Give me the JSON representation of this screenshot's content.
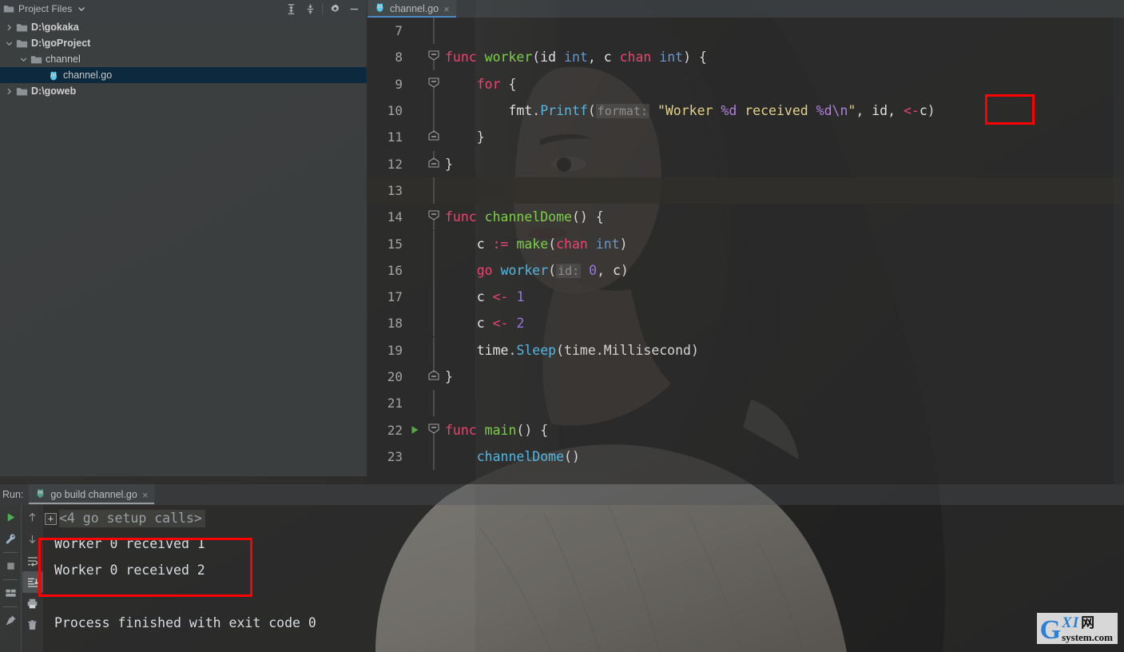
{
  "window": {
    "theme_accent": "#4a88c7",
    "annotation_color": "#ff0000"
  },
  "project_panel": {
    "title": "Project Files",
    "icons": {
      "dropdown": "chevron-down-icon",
      "expand_all": "expand-all-icon",
      "collapse_all": "collapse-all-icon",
      "settings": "gear-icon",
      "hide": "minimize-icon"
    },
    "tree": [
      {
        "label": "D:\\gokaka",
        "depth": 1,
        "kind": "folder",
        "expanded": false,
        "bold": true,
        "selected": false
      },
      {
        "label": "D:\\goProject",
        "depth": 1,
        "kind": "folder",
        "expanded": true,
        "bold": true,
        "selected": false
      },
      {
        "label": "channel",
        "depth": 2,
        "kind": "folder",
        "expanded": true,
        "bold": false,
        "selected": false
      },
      {
        "label": "channel.go",
        "depth": 3,
        "kind": "gofile",
        "expanded": null,
        "bold": false,
        "selected": true
      },
      {
        "label": "D:\\goweb",
        "depth": 1,
        "kind": "folder",
        "expanded": false,
        "bold": true,
        "selected": false
      }
    ]
  },
  "editor": {
    "tab": {
      "label": "channel.go",
      "icon": "go-gopher-icon",
      "close": "×",
      "active": true
    },
    "current_line": 13,
    "run_marker_line": 22,
    "lines": [
      {
        "n": 7,
        "fold": "none",
        "run": false,
        "current": false,
        "tokens": []
      },
      {
        "n": 8,
        "fold": "open",
        "run": false,
        "current": false,
        "tokens": [
          {
            "t": "func ",
            "c": "t-kw2"
          },
          {
            "t": "worker",
            "c": "t-fn"
          },
          {
            "t": "(",
            "c": "t-plain"
          },
          {
            "t": "id ",
            "c": "t-var"
          },
          {
            "t": "int",
            "c": "t-type"
          },
          {
            "t": ", ",
            "c": "t-plain"
          },
          {
            "t": "c ",
            "c": "t-var"
          },
          {
            "t": "chan ",
            "c": "t-kw2"
          },
          {
            "t": "int",
            "c": "t-type"
          },
          {
            "t": ") {",
            "c": "t-plain"
          }
        ]
      },
      {
        "n": 9,
        "fold": "open",
        "run": false,
        "current": false,
        "tokens": [
          {
            "t": "    ",
            "c": "t-plain"
          },
          {
            "t": "for",
            "c": "t-kw2"
          },
          {
            "t": " {",
            "c": "t-plain"
          }
        ]
      },
      {
        "n": 10,
        "fold": "none",
        "run": false,
        "current": false,
        "tokens": [
          {
            "t": "        ",
            "c": "t-plain"
          },
          {
            "t": "fmt",
            "c": "t-var"
          },
          {
            "t": ".",
            "c": "t-plain"
          },
          {
            "t": "Printf",
            "c": "t-call"
          },
          {
            "t": "(",
            "c": "t-plain"
          },
          {
            "t": "format:",
            "c": "hint"
          },
          {
            "t": "\"Worker ",
            "c": "t-str"
          },
          {
            "t": "%d",
            "c": "t-fmt"
          },
          {
            "t": " received ",
            "c": "t-str"
          },
          {
            "t": "%d",
            "c": "t-fmt"
          },
          {
            "t": "\\n",
            "c": "t-fmt"
          },
          {
            "t": "\"",
            "c": "t-str"
          },
          {
            "t": ", ",
            "c": "t-plain"
          },
          {
            "t": "id",
            "c": "t-var"
          },
          {
            "t": ", ",
            "c": "t-plain"
          },
          {
            "t": "<-",
            "c": "t-arrow"
          },
          {
            "t": "c",
            "c": "t-var"
          },
          {
            "t": ")",
            "c": "t-plain"
          }
        ]
      },
      {
        "n": 11,
        "fold": "close",
        "run": false,
        "current": false,
        "tokens": [
          {
            "t": "    }",
            "c": "t-plain"
          }
        ]
      },
      {
        "n": 12,
        "fold": "close",
        "run": false,
        "current": false,
        "tokens": [
          {
            "t": "}",
            "c": "t-plain"
          }
        ]
      },
      {
        "n": 13,
        "fold": "none",
        "run": false,
        "current": true,
        "tokens": []
      },
      {
        "n": 14,
        "fold": "open",
        "run": false,
        "current": false,
        "tokens": [
          {
            "t": "func ",
            "c": "t-kw2"
          },
          {
            "t": "channelDome",
            "c": "t-fn"
          },
          {
            "t": "() {",
            "c": "t-plain"
          }
        ]
      },
      {
        "n": 15,
        "fold": "none",
        "run": false,
        "current": false,
        "tokens": [
          {
            "t": "    ",
            "c": "t-plain"
          },
          {
            "t": "c ",
            "c": "t-var"
          },
          {
            "t": ":=",
            "c": "t-arrow"
          },
          {
            "t": " ",
            "c": "t-plain"
          },
          {
            "t": "make",
            "c": "t-fn"
          },
          {
            "t": "(",
            "c": "t-plain"
          },
          {
            "t": "chan ",
            "c": "t-kw2"
          },
          {
            "t": "int",
            "c": "t-type"
          },
          {
            "t": ")",
            "c": "t-plain"
          }
        ]
      },
      {
        "n": 16,
        "fold": "none",
        "run": false,
        "current": false,
        "tokens": [
          {
            "t": "    ",
            "c": "t-plain"
          },
          {
            "t": "go ",
            "c": "t-kw2"
          },
          {
            "t": "worker",
            "c": "t-call"
          },
          {
            "t": "(",
            "c": "t-plain"
          },
          {
            "t": "id:",
            "c": "hint"
          },
          {
            "t": "0",
            "c": "t-num"
          },
          {
            "t": ", ",
            "c": "t-plain"
          },
          {
            "t": "c",
            "c": "t-var"
          },
          {
            "t": ")",
            "c": "t-plain"
          }
        ]
      },
      {
        "n": 17,
        "fold": "none",
        "run": false,
        "current": false,
        "tokens": [
          {
            "t": "    ",
            "c": "t-plain"
          },
          {
            "t": "c ",
            "c": "t-var"
          },
          {
            "t": "<-",
            "c": "t-arrow"
          },
          {
            "t": " ",
            "c": "t-plain"
          },
          {
            "t": "1",
            "c": "t-num"
          }
        ]
      },
      {
        "n": 18,
        "fold": "none",
        "run": false,
        "current": false,
        "tokens": [
          {
            "t": "    ",
            "c": "t-plain"
          },
          {
            "t": "c ",
            "c": "t-var"
          },
          {
            "t": "<-",
            "c": "t-arrow"
          },
          {
            "t": " ",
            "c": "t-plain"
          },
          {
            "t": "2",
            "c": "t-num"
          }
        ]
      },
      {
        "n": 19,
        "fold": "none",
        "run": false,
        "current": false,
        "tokens": [
          {
            "t": "    ",
            "c": "t-plain"
          },
          {
            "t": "time",
            "c": "t-var"
          },
          {
            "t": ".",
            "c": "t-plain"
          },
          {
            "t": "Sleep",
            "c": "t-call"
          },
          {
            "t": "(time.Millisecond)",
            "c": "t-plain"
          }
        ]
      },
      {
        "n": 20,
        "fold": "close",
        "run": false,
        "current": false,
        "tokens": [
          {
            "t": "}",
            "c": "t-plain"
          }
        ]
      },
      {
        "n": 21,
        "fold": "none",
        "run": false,
        "current": false,
        "tokens": []
      },
      {
        "n": 22,
        "fold": "open",
        "run": true,
        "current": false,
        "tokens": [
          {
            "t": "func ",
            "c": "t-kw2"
          },
          {
            "t": "main",
            "c": "t-fn"
          },
          {
            "t": "() {",
            "c": "t-plain"
          }
        ]
      },
      {
        "n": 23,
        "fold": "none",
        "run": false,
        "current": false,
        "tokens": [
          {
            "t": "    ",
            "c": "t-plain"
          },
          {
            "t": "channelDome",
            "c": "t-call"
          },
          {
            "t": "()",
            "c": "t-plain"
          }
        ]
      }
    ]
  },
  "run_panel": {
    "label": "Run:",
    "tab": {
      "label": "go build channel.go",
      "icon": "go-gopher-icon",
      "close": "×"
    },
    "left_rail": [
      {
        "name": "rerun-button",
        "icon": "play-icon"
      },
      {
        "name": "settings-button",
        "icon": "wrench-icon"
      },
      {
        "name": "stop-button",
        "icon": "stop-square-icon"
      },
      {
        "name": "layout-button",
        "icon": "layout-icon"
      },
      {
        "name": "pin-tab-button",
        "icon": "pin-icon"
      }
    ],
    "second_rail": [
      {
        "name": "up-stack-button",
        "icon": "arrow-up-icon",
        "active": false
      },
      {
        "name": "down-stack-button",
        "icon": "arrow-down-icon",
        "active": false
      },
      {
        "name": "soft-wrap-button",
        "icon": "soft-wrap-icon",
        "active": false
      },
      {
        "name": "scroll-to-end-button",
        "icon": "scroll-to-end-icon",
        "active": true
      },
      {
        "name": "print-button",
        "icon": "print-icon",
        "active": false
      },
      {
        "name": "clear-all-button",
        "icon": "trash-icon",
        "active": false
      }
    ],
    "console": {
      "fold_glyph": "+",
      "setup_calls": "<4 go setup calls>",
      "output": [
        "Worker 0 received 1",
        "Worker 0 received 2",
        "",
        "Process finished with exit code 0"
      ]
    }
  },
  "watermark": {
    "g": "G",
    "xi": "XI",
    "cn": "网",
    "domain": "system.com"
  }
}
